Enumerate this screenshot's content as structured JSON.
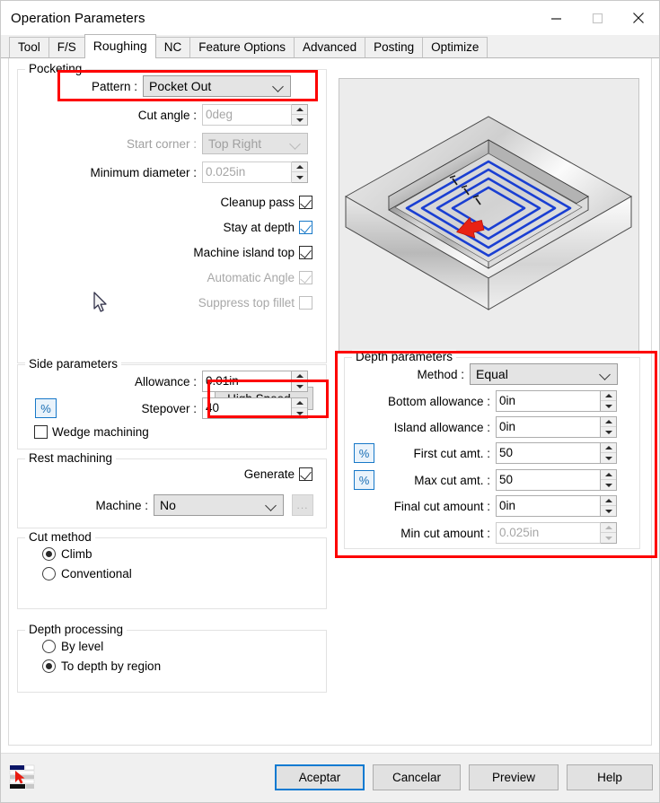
{
  "window": {
    "title": "Operation Parameters",
    "controls": {
      "minimize": "minimize-icon",
      "maximize": "maximize-icon",
      "close": "close-icon"
    }
  },
  "tabs": [
    {
      "label": "Tool",
      "active": false
    },
    {
      "label": "F/S",
      "active": false
    },
    {
      "label": "Roughing",
      "active": true
    },
    {
      "label": "NC",
      "active": false
    },
    {
      "label": "Feature Options",
      "active": false
    },
    {
      "label": "Advanced",
      "active": false
    },
    {
      "label": "Posting",
      "active": false
    },
    {
      "label": "Optimize",
      "active": false
    }
  ],
  "pocketing": {
    "title": "Pocketing",
    "pattern_label": "Pattern :",
    "pattern_value": "Pocket Out",
    "cut_angle_label": "Cut angle :",
    "cut_angle_value": "0deg",
    "start_corner_label": "Start corner :",
    "start_corner_value": "Top Right",
    "min_diameter_label": "Minimum diameter :",
    "min_diameter_value": "0.025in",
    "cleanup_pass_label": "Cleanup pass",
    "stay_at_depth_label": "Stay at depth",
    "machine_island_top_label": "Machine island top",
    "automatic_angle_label": "Automatic Angle",
    "suppress_top_fillet_label": "Suppress top fillet",
    "high_speed_label": "High Speed..."
  },
  "side_parameters": {
    "title": "Side parameters",
    "allowance_label": "Allowance :",
    "allowance_value": "0.01in",
    "stepover_label": "Stepover :",
    "stepover_value": "40",
    "percent_label": "%",
    "wedge_machining_label": "Wedge machining"
  },
  "rest_machining": {
    "title": "Rest machining",
    "generate_label": "Generate",
    "machine_label": "Machine :",
    "machine_value": "No",
    "browse_label": "..."
  },
  "cut_method": {
    "title": "Cut method",
    "options": [
      "Climb",
      "Conventional"
    ],
    "selected": "Climb"
  },
  "depth_processing": {
    "title": "Depth processing",
    "options": [
      "By level",
      "To depth by region"
    ],
    "selected": "To depth by region"
  },
  "depth_parameters": {
    "title": "Depth parameters",
    "method_label": "Method :",
    "method_value": "Equal",
    "bottom_allowance_label": "Bottom allowance :",
    "bottom_allowance_value": "0in",
    "island_allowance_label": "Island allowance :",
    "island_allowance_value": "0in",
    "first_cut_label": "First cut amt. :",
    "first_cut_value": "50",
    "max_cut_label": "Max cut amt. :",
    "max_cut_value": "50",
    "final_cut_label": "Final cut amount :",
    "final_cut_value": "0in",
    "min_cut_label": "Min cut amount :",
    "min_cut_value": "0.025in",
    "percent_label": "%"
  },
  "preview_pane": {
    "name": "toolpath-preview",
    "description": "Isometric pocket part with blue spiral toolpath and red direction arrow"
  },
  "footer": {
    "accept_label": "Aceptar",
    "cancel_label": "Cancelar",
    "preview_label": "Preview",
    "help_label": "Help"
  },
  "colors": {
    "annotation_red": "#fd0000",
    "accent_blue": "#1778c8",
    "toolpath_blue": "#1a3fd2",
    "arrow_red": "#e82214",
    "primary_button_border": "#0b7ad1"
  }
}
